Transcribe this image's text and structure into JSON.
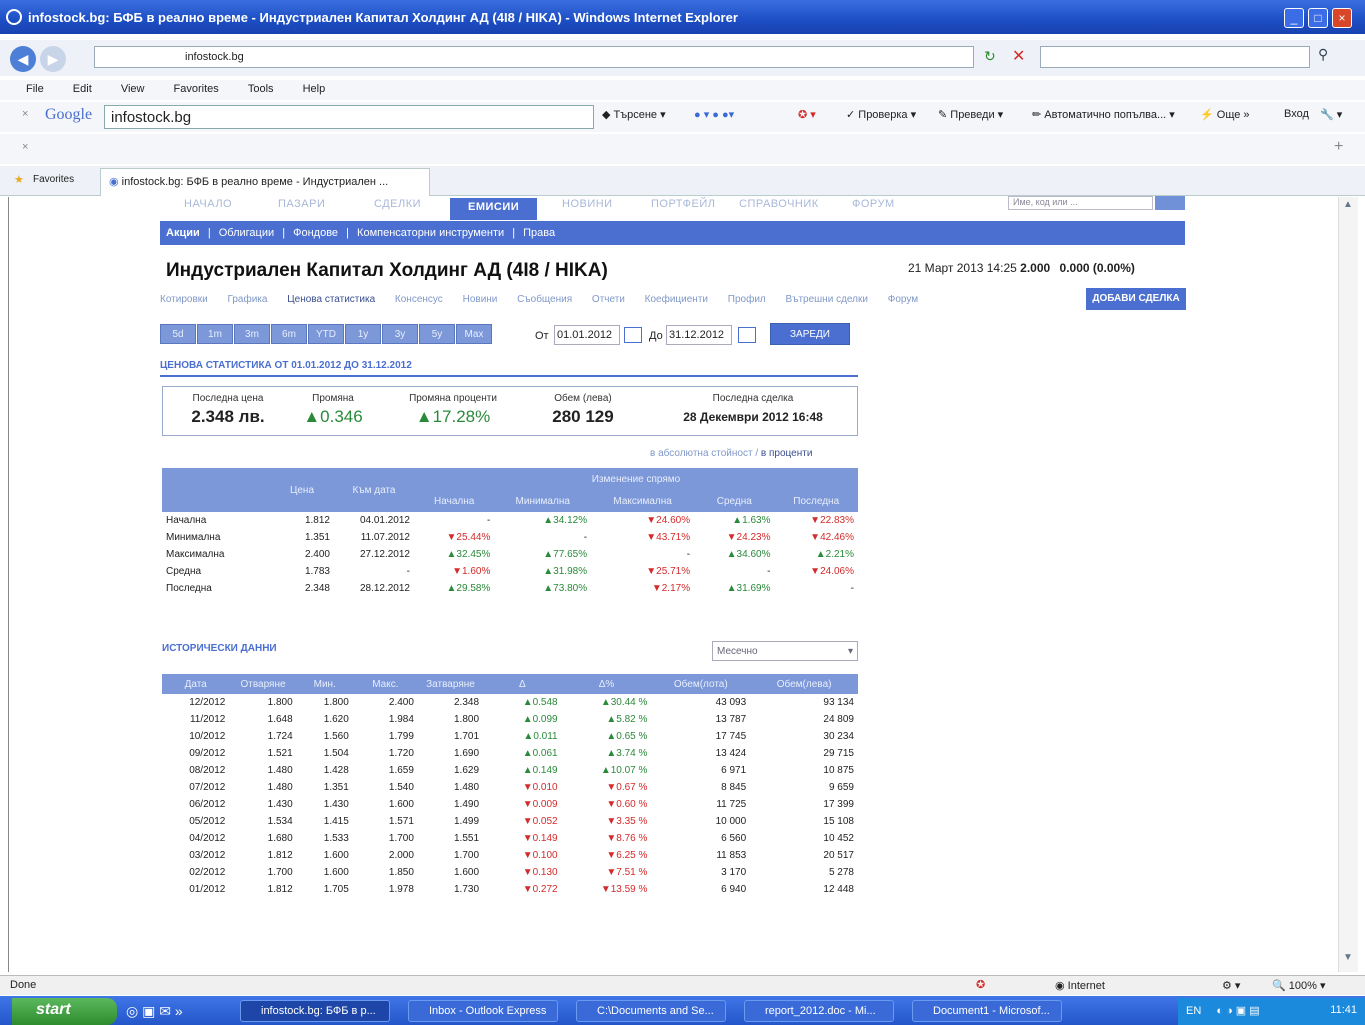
{
  "window": {
    "title": "infostock.bg: БФБ в реално време - Индустриален Капитал Холдинг АД (4I8 / HIKA) - Windows Internet Explorer"
  },
  "address": {
    "url": "infostock.bg"
  },
  "menu": [
    "File",
    "Edit",
    "View",
    "Favorites",
    "Tools",
    "Help"
  ],
  "google": {
    "logo": "Google",
    "query": "infostock.bg",
    "items": [
      "Търсене",
      "Проверка",
      "Преведи",
      "Автоматично попълва...",
      "Още »",
      "Вход"
    ]
  },
  "favorites": {
    "label": "Favorites",
    "tab": "infostock.bg: БФБ в реално време - Индустриален ..."
  },
  "site_tabs": [
    "НАЧАЛО",
    "ПАЗАРИ",
    "СДЕЛКИ",
    "ЕМИСИИ",
    "НОВИНИ",
    "ПОРТФЕЙЛ",
    "СПРАВОЧНИК",
    "ФОРУМ"
  ],
  "site_search_placeholder": "Име, код или ...",
  "subnav": [
    "Акции",
    "|",
    "Облигации",
    "|",
    "Фондове",
    "|",
    "Компенсаторни инструменти",
    "|",
    "Права"
  ],
  "company": "Индустриален Капитал Холдинг АД (4I8 / HIKA)",
  "quote": {
    "datetime": "21 Март 2013 14:25",
    "price": "2.000",
    "change": "0.000 (0.00%)"
  },
  "inner_nav": [
    "Котировки",
    "Графика",
    "Ценова статистика",
    "Консенсус",
    "Новини",
    "Съобщения",
    "Отчети",
    "Коефициенти",
    "Профил",
    "Вътрешни сделки",
    "Форум"
  ],
  "add_deal": "ДОБАВИ СДЕЛКА",
  "periods": [
    "5d",
    "1m",
    "3m",
    "6m",
    "YTD",
    "1y",
    "3y",
    "5y",
    "Max"
  ],
  "range": {
    "from_label": "От",
    "from": "01.01.2012",
    "to_label": "До",
    "to": "31.12.2012",
    "load": "ЗАРЕДИ"
  },
  "stat_heading": "ЦЕНОВА СТАТИСТИКА ОТ 01.01.2012 ДО 31.12.2012",
  "stats": {
    "last_price_label": "Последна цена",
    "last_price": "2.348 лв.",
    "change_label": "Промяна",
    "change": "▲0.346",
    "change_pct_label": "Промяна проценти",
    "change_pct": "▲17.28%",
    "volume_label": "Обем (левa)",
    "volume": "280 129",
    "last_deal_label": "Последна сделка",
    "last_deal": "28 Декември 2012 16:48"
  },
  "abs_link": {
    "a": "в абсолютна стойност",
    "sep": "/",
    "b": "в проценти"
  },
  "change_table": {
    "group": "Изменение спрямо",
    "headers": [
      "",
      "Цена",
      "Към дата",
      "Начална",
      "Минимална",
      "Максимална",
      "Средна",
      "Последна"
    ],
    "rows": [
      {
        "name": "Начална",
        "price": "1.812",
        "date": "04.01.2012",
        "c": [
          [
            "-",
            ""
          ],
          [
            "▲34.12%",
            "grn"
          ],
          [
            "▼24.60%",
            "red"
          ],
          [
            "▲1.63%",
            "grn"
          ],
          [
            "▼22.83%",
            "red"
          ]
        ]
      },
      {
        "name": "Минимална",
        "price": "1.351",
        "date": "11.07.2012",
        "c": [
          [
            "▼25.44%",
            "red"
          ],
          [
            "-",
            ""
          ],
          [
            "▼43.71%",
            "red"
          ],
          [
            "▼24.23%",
            "red"
          ],
          [
            "▼42.46%",
            "red"
          ]
        ]
      },
      {
        "name": "Максимална",
        "price": "2.400",
        "date": "27.12.2012",
        "c": [
          [
            "▲32.45%",
            "grn"
          ],
          [
            "▲77.65%",
            "grn"
          ],
          [
            "-",
            ""
          ],
          [
            "▲34.60%",
            "grn"
          ],
          [
            "▲2.21%",
            "grn"
          ]
        ]
      },
      {
        "name": "Средна",
        "price": "1.783",
        "date": "-",
        "c": [
          [
            "▼1.60%",
            "red"
          ],
          [
            "▲31.98%",
            "grn"
          ],
          [
            "▼25.71%",
            "red"
          ],
          [
            "-",
            ""
          ],
          [
            "▼24.06%",
            "red"
          ]
        ]
      },
      {
        "name": "Последна",
        "price": "2.348",
        "date": "28.12.2012",
        "c": [
          [
            "▲29.58%",
            "grn"
          ],
          [
            "▲73.80%",
            "grn"
          ],
          [
            "▼2.17%",
            "red"
          ],
          [
            "▲31.69%",
            "grn"
          ],
          [
            "-",
            ""
          ]
        ]
      }
    ]
  },
  "hist_heading": "ИСТОРИЧЕСКИ ДАННИ",
  "hist_select": "Месечно",
  "hist_table": {
    "headers": [
      "Дата",
      "Отваряне",
      "Мин.",
      "Макс.",
      "Затваряне",
      "Δ",
      "Δ%",
      "Обем(лота)",
      "Обем(левa)"
    ],
    "rows": [
      [
        "12/2012",
        "1.800",
        "1.800",
        "2.400",
        "2.348",
        "▲0.548",
        "▲30.44 %",
        "43 093",
        "93 134",
        "grn"
      ],
      [
        "11/2012",
        "1.648",
        "1.620",
        "1.984",
        "1.800",
        "▲0.099",
        "▲5.82 %",
        "13 787",
        "24 809",
        "grn"
      ],
      [
        "10/2012",
        "1.724",
        "1.560",
        "1.799",
        "1.701",
        "▲0.011",
        "▲0.65 %",
        "17 745",
        "30 234",
        "grn"
      ],
      [
        "09/2012",
        "1.521",
        "1.504",
        "1.720",
        "1.690",
        "▲0.061",
        "▲3.74 %",
        "13 424",
        "29 715",
        "grn"
      ],
      [
        "08/2012",
        "1.480",
        "1.428",
        "1.659",
        "1.629",
        "▲0.149",
        "▲10.07 %",
        "6 971",
        "10 875",
        "grn"
      ],
      [
        "07/2012",
        "1.480",
        "1.351",
        "1.540",
        "1.480",
        "▼0.010",
        "▼0.67 %",
        "8 845",
        "9 659",
        "red"
      ],
      [
        "06/2012",
        "1.430",
        "1.430",
        "1.600",
        "1.490",
        "▼0.009",
        "▼0.60 %",
        "11 725",
        "17 399",
        "red"
      ],
      [
        "05/2012",
        "1.534",
        "1.415",
        "1.571",
        "1.499",
        "▼0.052",
        "▼3.35 %",
        "10 000",
        "15 108",
        "red"
      ],
      [
        "04/2012",
        "1.680",
        "1.533",
        "1.700",
        "1.551",
        "▼0.149",
        "▼8.76 %",
        "6 560",
        "10 452",
        "red"
      ],
      [
        "03/2012",
        "1.812",
        "1.600",
        "2.000",
        "1.700",
        "▼0.100",
        "▼6.25 %",
        "11 853",
        "20 517",
        "red"
      ],
      [
        "02/2012",
        "1.700",
        "1.600",
        "1.850",
        "1.600",
        "▼0.130",
        "▼7.51 %",
        "3 170",
        "5 278",
        "red"
      ],
      [
        "01/2012",
        "1.812",
        "1.705",
        "1.978",
        "1.730",
        "▼0.272",
        "▼13.59 %",
        "6 940",
        "12 448",
        "red"
      ]
    ]
  },
  "statusbar": {
    "left": "Done",
    "zone": "Internet",
    "zoom": "100%"
  },
  "taskbar": {
    "start": "start",
    "tasks": [
      "infostock.bg: БФБ в р...",
      "Inbox - Outlook Express",
      "C:\\Documents and Se...",
      "report_2012.doc - Mi...",
      "Document1 - Microsof..."
    ],
    "lang": "EN",
    "clock": "11:41"
  }
}
